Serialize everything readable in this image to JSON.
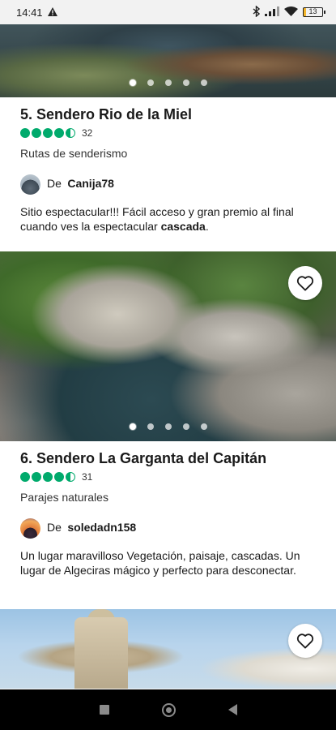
{
  "status_bar": {
    "time": "14:41",
    "battery": "13"
  },
  "cards": [
    {
      "title": "5. Sendero Rio de la Miel",
      "rating_count": "32",
      "category": "Rutas de senderismo",
      "by_label": "De",
      "author": "Canija78",
      "review_text": "Sitio espectacular!!! Fácil acceso y gran premio al final cuando ves la espectacular ",
      "review_bold": "cascada",
      "review_end": "."
    },
    {
      "title": "6. Sendero La Garganta del Capitán",
      "rating_count": "31",
      "category": "Parajes naturales",
      "by_label": "De",
      "author": "soledadn158",
      "review_text": "Un lugar maravilloso Vegetación, paisaje, cascadas. Un lugar de Algeciras mágico y perfecto para desconectar."
    }
  ],
  "rating_value": 4.5,
  "colors": {
    "rating_green": "#00aa6c",
    "status_bg": "#f2f2f2",
    "nav_bg": "#000000"
  },
  "icons": [
    "warning-icon",
    "bluetooth-icon",
    "signal-icon",
    "wifi-icon",
    "battery-icon",
    "heart-icon",
    "recents-icon",
    "home-icon",
    "back-icon"
  ]
}
